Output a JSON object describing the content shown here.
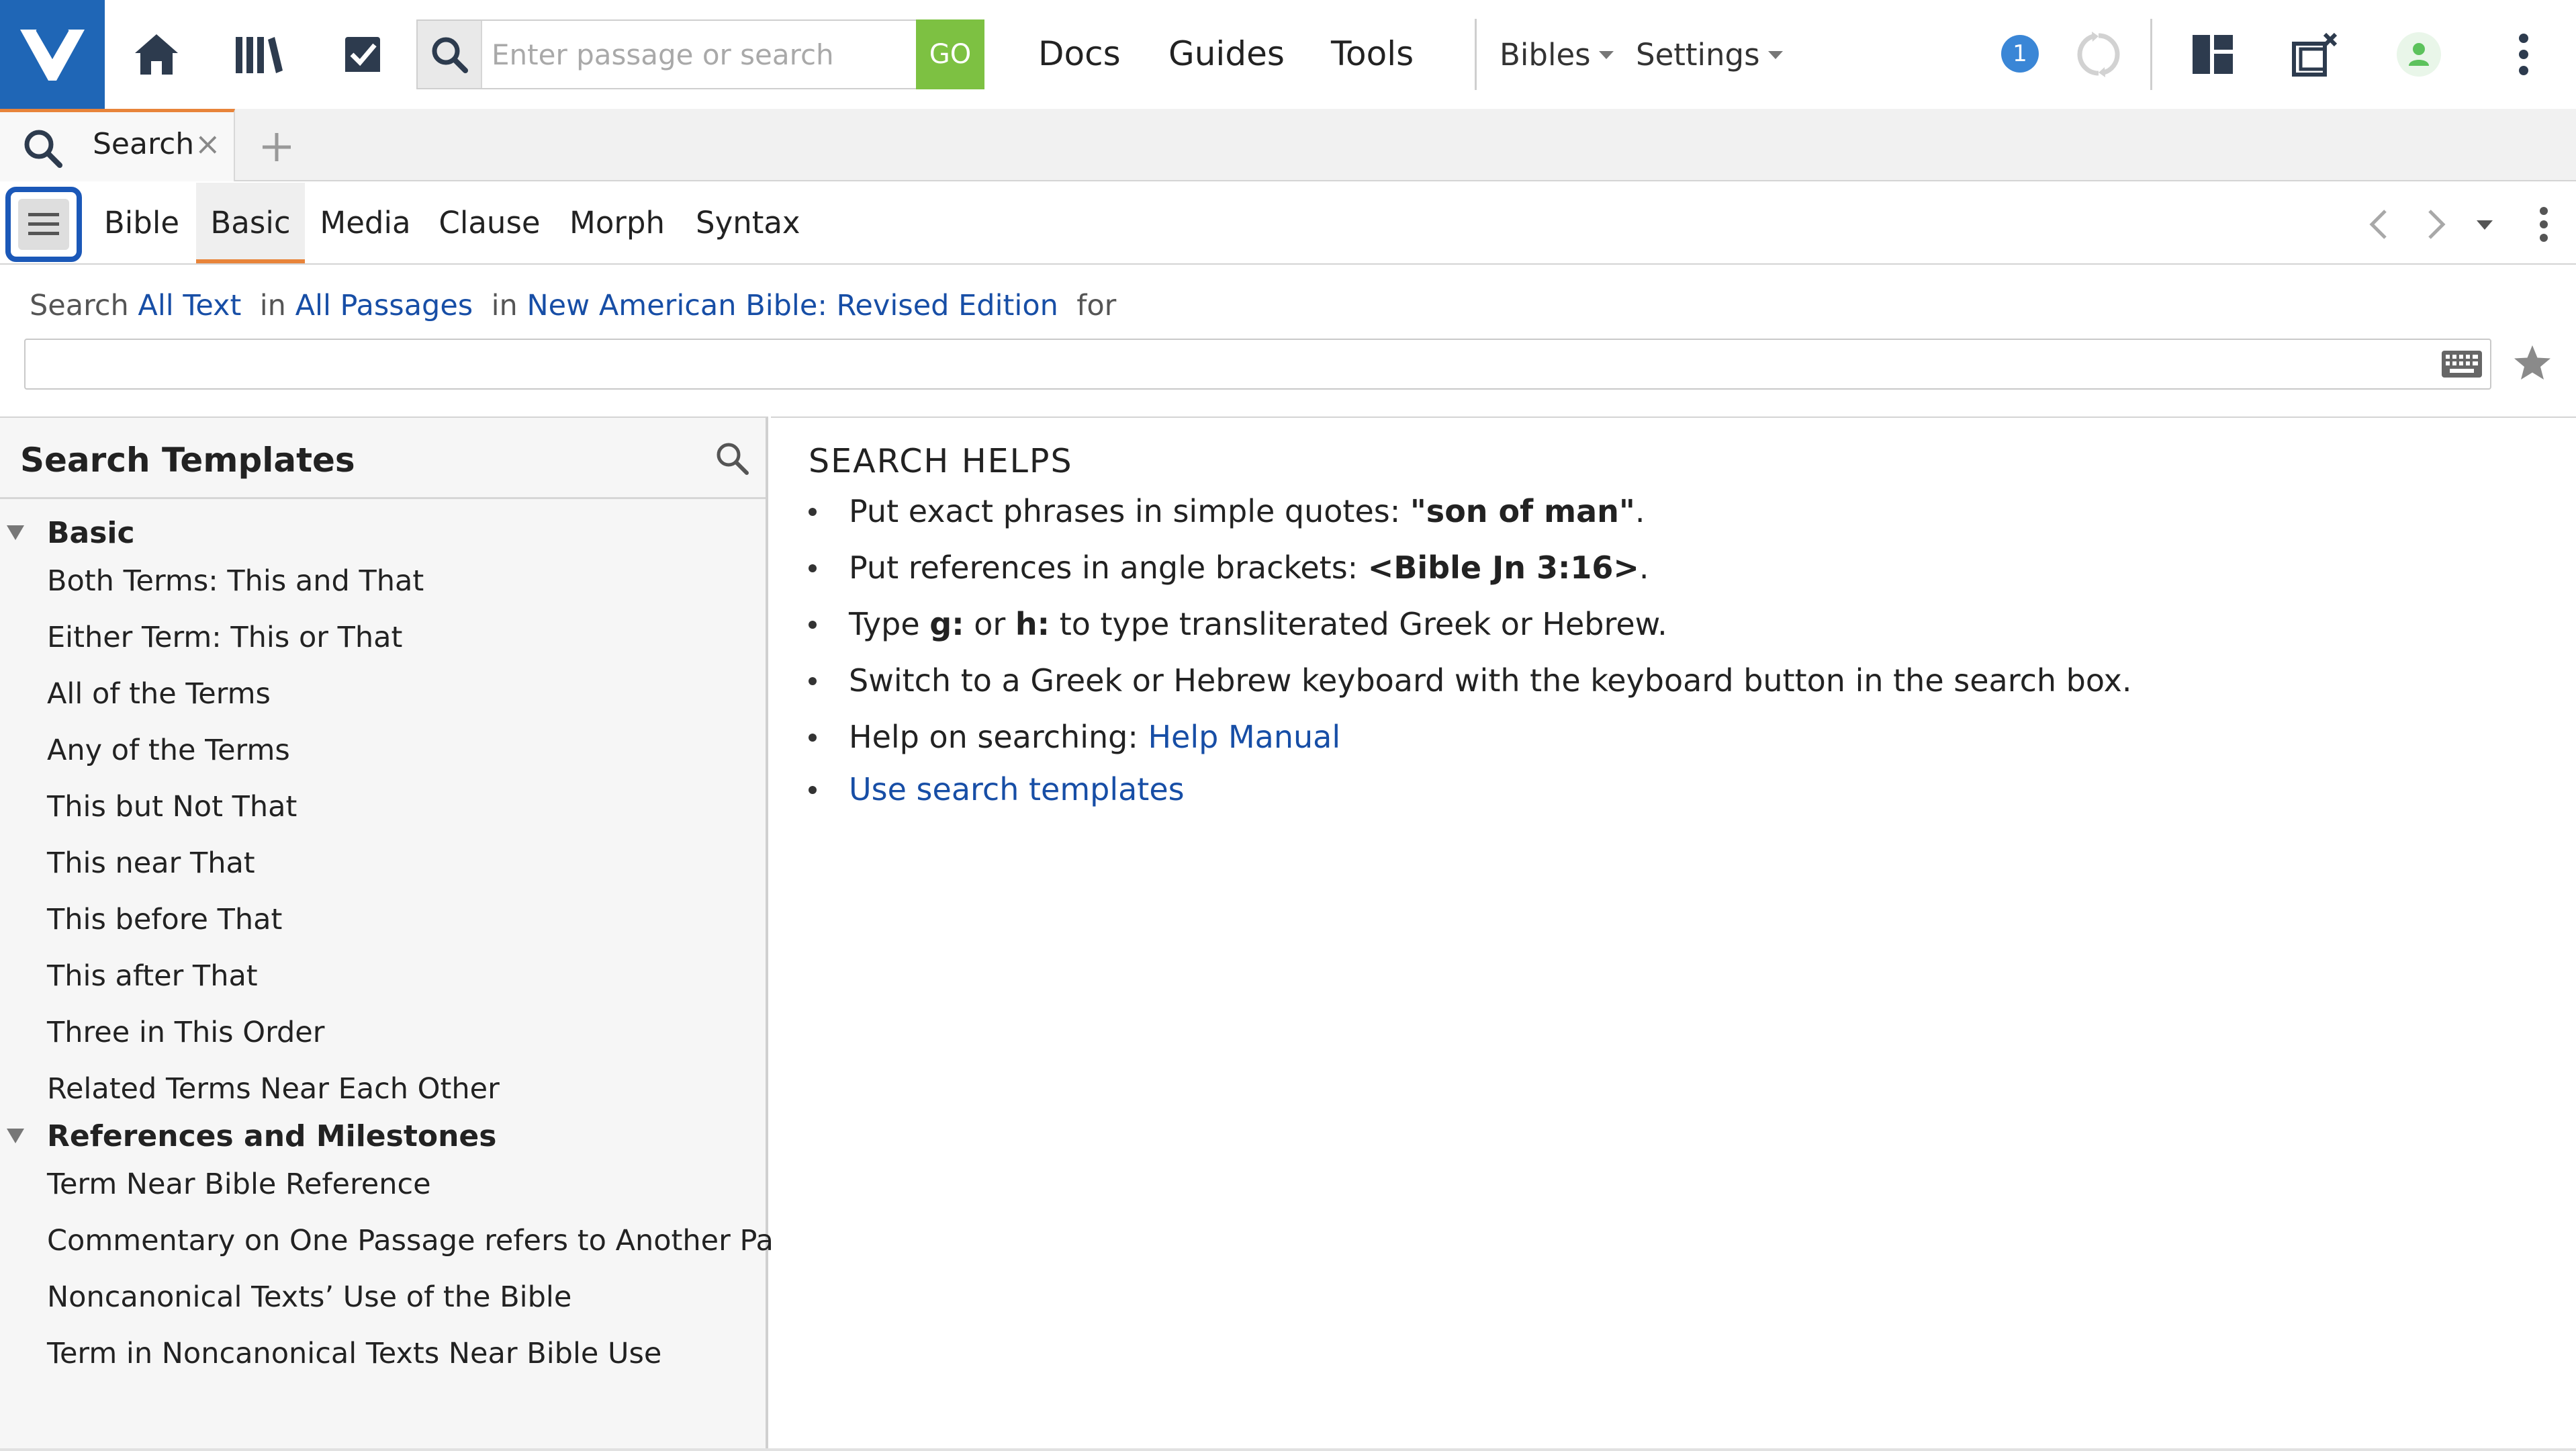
{
  "colors": {
    "brand": "#1f66b6",
    "go_button": "#7dc142",
    "active_tab_accent": "#e8843a",
    "link": "#174ea6",
    "badge": "#3a86d6",
    "user_status": "#5cc25c",
    "focus_ring": "#1b58b8"
  },
  "topbar": {
    "logo_icon": "logos-logo-icon",
    "home_icon": "home-icon",
    "library_icon": "library-icon",
    "tasks_icon": "checkbox-icon",
    "search_placeholder": "Enter passage or search",
    "go_label": "GO",
    "nav": [
      "Docs",
      "Guides",
      "Tools"
    ],
    "bibles_label": "Bibles",
    "settings_label": "Settings",
    "notification_count": "1",
    "sync_icon": "sync-icon",
    "layouts_icon": "layouts-icon",
    "close_panels_icon": "close-panels-icon",
    "user_icon": "user-icon",
    "more_icon": "more-vertical-icon"
  },
  "tabbar": {
    "tab_label": "Search",
    "tab_close": "×",
    "add_icon": "plus-icon"
  },
  "search_types": {
    "menu_icon": "hamburger-icon",
    "tabs": [
      "Bible",
      "Basic",
      "Media",
      "Clause",
      "Morph",
      "Syntax"
    ],
    "active_tab": "Basic"
  },
  "query": {
    "search_word": "Search",
    "scope": "All Text",
    "in_1": "in",
    "range": "All Passages",
    "in_2": "in",
    "resource": "New American Bible: Revised Edition",
    "for_word": "for",
    "value": ""
  },
  "templates": {
    "title": "Search Templates",
    "groups": [
      {
        "label": "Basic",
        "items": [
          "Both Terms: This and That",
          "Either Term: This or That",
          "All of the Terms",
          "Any of the Terms",
          "This but Not That",
          "This near That",
          "This before That",
          "This after That",
          "Three in This Order",
          "Related Terms Near Each Other"
        ]
      },
      {
        "label": "References and Milestones",
        "items": [
          "Term Near Bible Reference",
          "Commentary on One Passage refers to Another Passage",
          "Noncanonical Texts’ Use of the Bible",
          "Term in Noncanonical Texts Near Bible Use"
        ]
      }
    ]
  },
  "helps": {
    "title": "SEARCH HELPS",
    "line1_pre": "Put exact phrases in simple quotes: ",
    "line1_bold": "\"son of man\"",
    "line1_post": ".",
    "line2_pre": "Put references in angle brackets: ",
    "line2_bold": "<Bible Jn 3:16>",
    "line2_post": ".",
    "line3_a": "Type ",
    "line3_b": "g:",
    "line3_c": " or ",
    "line3_d": "h:",
    "line3_e": " to type transliterated Greek or Hebrew.",
    "line4": "Switch to a Greek or Hebrew keyboard with the keyboard button in the search box.",
    "line5_pre": "Help on searching: ",
    "line5_link": "Help Manual",
    "line6_link": "Use search templates"
  }
}
